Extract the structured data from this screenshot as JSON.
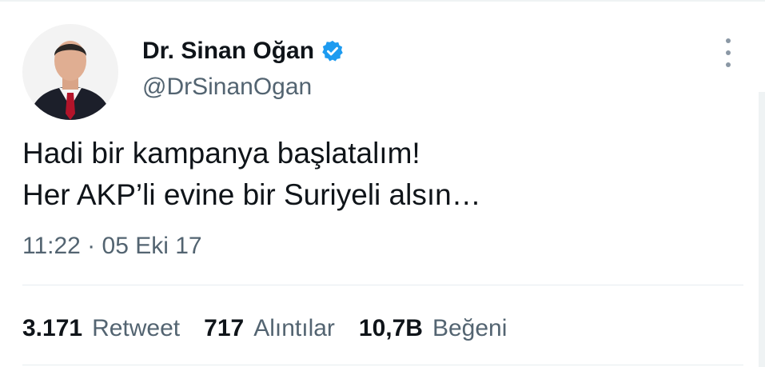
{
  "author": {
    "display_name": "Dr. Sinan Oğan",
    "handle": "@DrSinanOgan",
    "verified": true,
    "verified_color": "#1d9bf0"
  },
  "tweet": {
    "text": "Hadi bir kampanya başlatalım!\nHer AKP’li evine bir Suriyeli alsın…",
    "timestamp": "11:22 · 05 Eki 17"
  },
  "stats": [
    {
      "value": "3.171",
      "label": "Retweet"
    },
    {
      "value": "717",
      "label": "Alıntılar"
    },
    {
      "value": "10,7B",
      "label": "Beğeni"
    }
  ],
  "icons": {
    "verified": "verified-badge-icon",
    "more": "more-options-icon"
  }
}
